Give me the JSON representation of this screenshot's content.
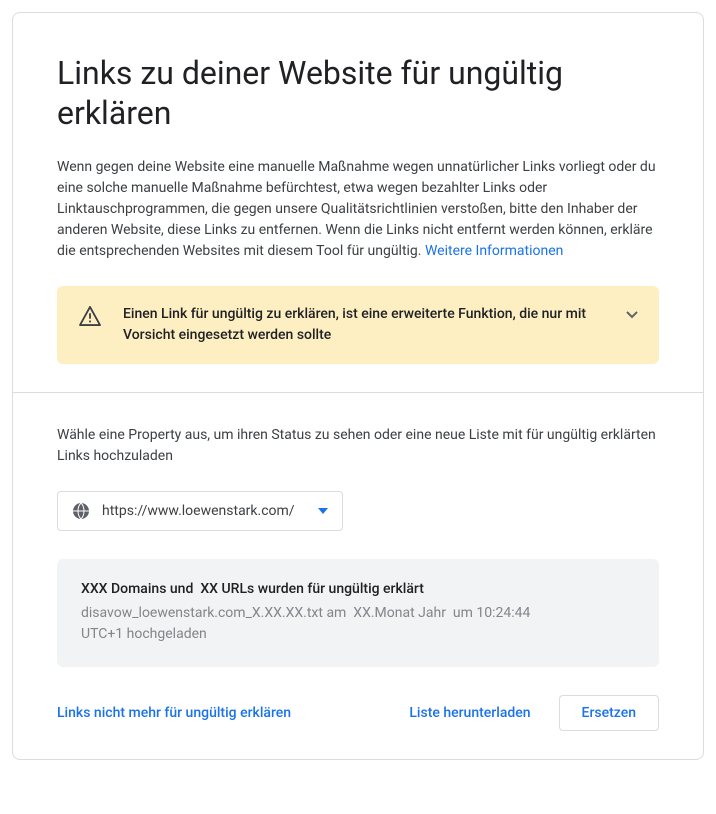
{
  "header": {
    "title": "Links zu deiner Website für ungültig erklären"
  },
  "intro": {
    "text": "Wenn gegen deine Website eine manuelle Maßnahme wegen unnatürlicher Links vorliegt oder du eine solche manuelle Maßnahme befürchtest, etwa wegen bezahlter Links oder Linktauschprogrammen, die gegen unsere Qualitätsrichtlinien verstoßen, bitte den Inhaber der anderen Website, diese Links zu entfernen. Wenn die Links nicht entfernt werden können, erkläre die entsprechenden Websites mit diesem Tool für ungültig. ",
    "link_text": "Weitere Informationen"
  },
  "alert": {
    "text": "Einen Link für ungültig zu erklären, ist eine erweiterte Funktion, die nur mit Vorsicht eingesetzt werden sollte"
  },
  "property": {
    "instruction": "Wähle eine Property aus, um ihren Status zu sehen oder eine neue Liste mit für ungültig erklärten Links hochzuladen",
    "selected_url": "https://www.loewenstark.com/"
  },
  "status": {
    "domains_count": "XXX",
    "domains_label": "Domains und",
    "urls_count": "XX",
    "urls_label": "URLs wurden für ungültig erklärt",
    "filename": "disavow_loewenstark.com_X.XX.XX.txt",
    "am": "am",
    "date": "XX.Monat Jahr",
    "um": "um",
    "time": "10:24:44 UTC+1",
    "uploaded": "hochgeladen"
  },
  "actions": {
    "undeclare": "Links nicht mehr für ungültig erklären",
    "download": "Liste herunterladen",
    "replace": "Ersetzen"
  }
}
